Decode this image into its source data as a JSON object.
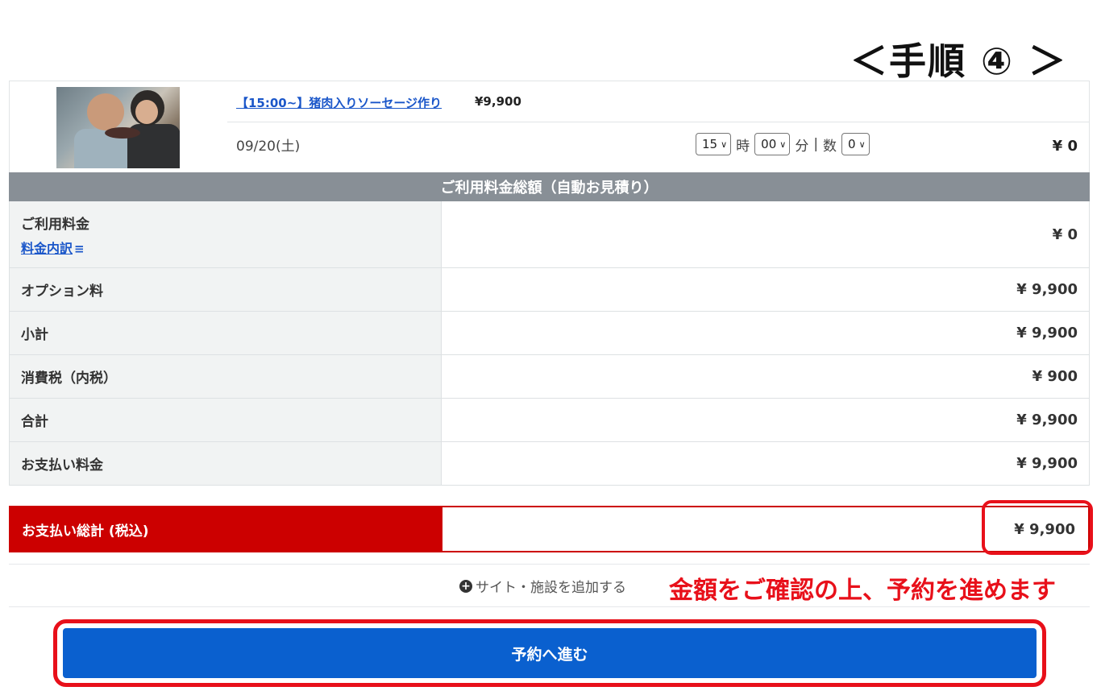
{
  "step_title": "＜手順 ④ ＞",
  "product": {
    "image_alt": "children making sausages",
    "link_label": "【15:00~】猪肉入りソーセージ作り",
    "price": "¥9,900",
    "date": "09/20(土)",
    "hour_value": "15",
    "hour_unit": "時",
    "minute_value": "00",
    "minute_unit": "分",
    "separator": "|",
    "count_label": "数",
    "count_value": "0",
    "amount": "¥ 0"
  },
  "summary": {
    "heading": "ご利用料金総額（自動お見積り）",
    "rows": [
      {
        "label": "ご利用料金",
        "sub_link": "料金内訳",
        "value": "¥ 0"
      },
      {
        "label": "オプション料",
        "value": "¥ 9,900"
      },
      {
        "label": "小計",
        "value": "¥ 9,900"
      },
      {
        "label": "消費税（内税）",
        "value": "¥ 900"
      },
      {
        "label": "合計",
        "value": "¥ 9,900"
      },
      {
        "label": "お支払い料金",
        "value": "¥ 9,900"
      }
    ]
  },
  "total": {
    "label": "お支払い総計 (税込)",
    "value": "¥ 9,900"
  },
  "add_site_label": "サイト・施設を追加する",
  "note": "金額をご確認の上、予約を進めます",
  "proceed_label": "予約へ進む",
  "colors": {
    "header_gray": "#888f96",
    "total_red": "#cc0000",
    "highlight_red": "#e8101a",
    "button_blue": "#0a60cf",
    "link_blue": "#1a56c9"
  }
}
